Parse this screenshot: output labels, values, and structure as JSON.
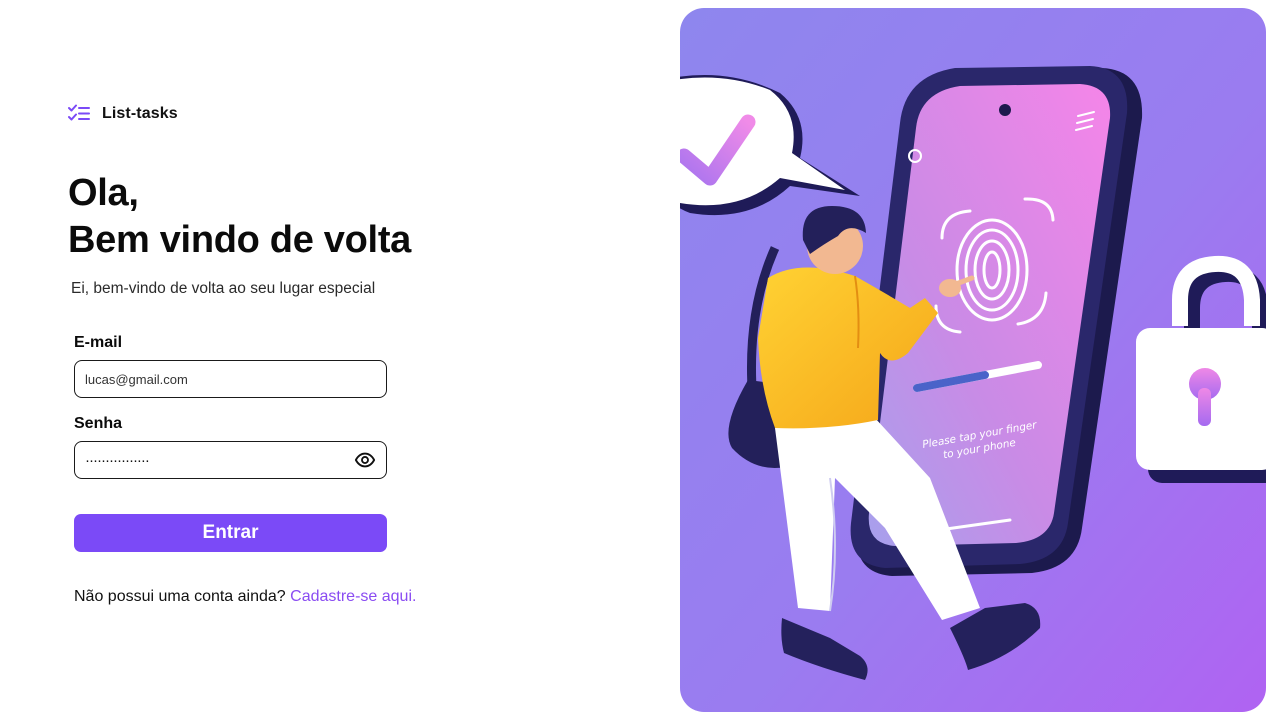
{
  "brand": {
    "name": "List-tasks",
    "icon": "checklist-icon"
  },
  "greeting": {
    "line1": "Ola,",
    "line2": "Bem vindo de volta"
  },
  "subtitle": "Ei, bem-vindo de volta ao seu lugar especial",
  "form": {
    "email_label": "E-mail",
    "email_value": "lucas@gmail.com",
    "password_label": "Senha",
    "password_value": "················",
    "password_toggle_icon": "eye-icon",
    "submit_label": "Entrar"
  },
  "signup": {
    "prompt": "Não possui uma conta ainda?",
    "link": "Cadastre-se aqui."
  },
  "illustration": {
    "caption_line1": "Please tap your finger",
    "caption_line2": "to your phone"
  },
  "colors": {
    "accent": "#7b4af7",
    "link": "#8a4cf2"
  }
}
